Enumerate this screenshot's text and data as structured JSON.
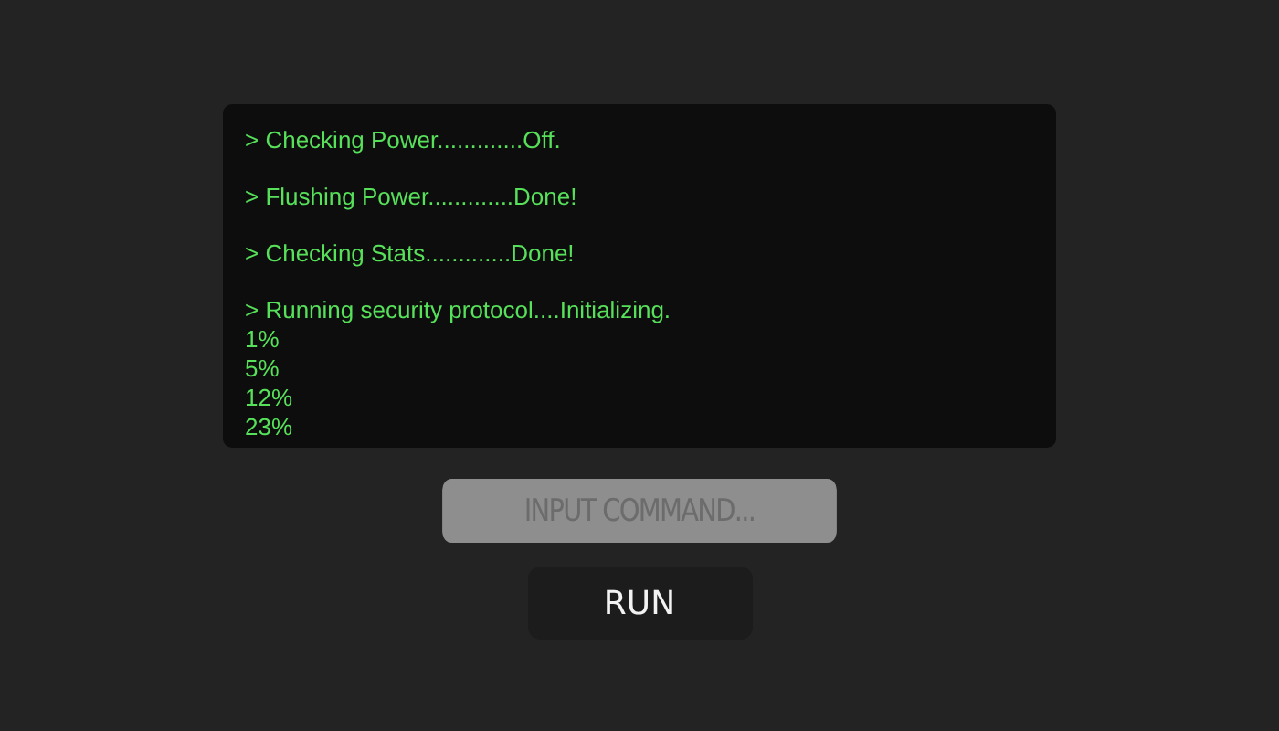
{
  "console": {
    "groups": [
      {
        "lines": [
          "> Checking Power.............Off."
        ]
      },
      {
        "lines": [
          "> Flushing Power.............Done!"
        ]
      },
      {
        "lines": [
          "> Checking Stats.............Done!"
        ]
      },
      {
        "lines": [
          "> Running security protocol....Initializing.",
          "1%",
          "5%",
          "12%",
          "23%"
        ]
      }
    ]
  },
  "command_field": {
    "placeholder": "INPUT COMMAND..."
  },
  "run_button": {
    "label": "RUN"
  }
}
